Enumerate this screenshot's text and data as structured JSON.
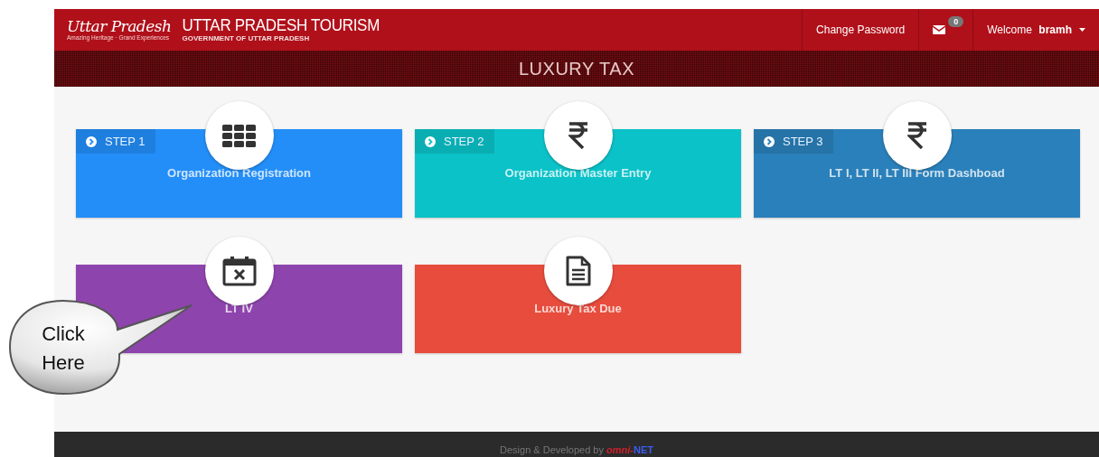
{
  "header": {
    "logo_script": "Uttar Pradesh",
    "logo_tagline": "Amazing Heritage · Grand Experiences",
    "title": "UTTAR PRADESH TOURISM",
    "subtitle": "GOVERNMENT OF UTTAR PRADESH",
    "nav": [
      {
        "kind": "link",
        "label": "Change Password"
      },
      {
        "kind": "mail",
        "badge": "0"
      },
      {
        "kind": "user",
        "label": "Welcome",
        "user": "bramh"
      }
    ]
  },
  "banner": {
    "title": "LUXURY TAX"
  },
  "tiles": [
    {
      "step": "STEP 1",
      "title": "Organization Registration",
      "kind": "grid",
      "color": "#238ef8"
    },
    {
      "step": "STEP 2",
      "title": "Organization Master Entry",
      "kind": "rupee",
      "color": "#0bc2c8"
    },
    {
      "step": "STEP 3",
      "title": "LT I, LT II, LT III Form Dashboad",
      "kind": "rupee",
      "color": "#2a80ba"
    },
    {
      "title": "LT IV",
      "kind": "calendar",
      "color": "#8e44ad"
    },
    {
      "title": "Luxury Tax Due",
      "kind": "document",
      "color": "#e74c3c"
    }
  ],
  "callout": {
    "text": "Click Here"
  },
  "footer": {
    "text": "Design & Developed by",
    "brand_prefix": "omni-",
    "brand_suffix": "NET"
  }
}
